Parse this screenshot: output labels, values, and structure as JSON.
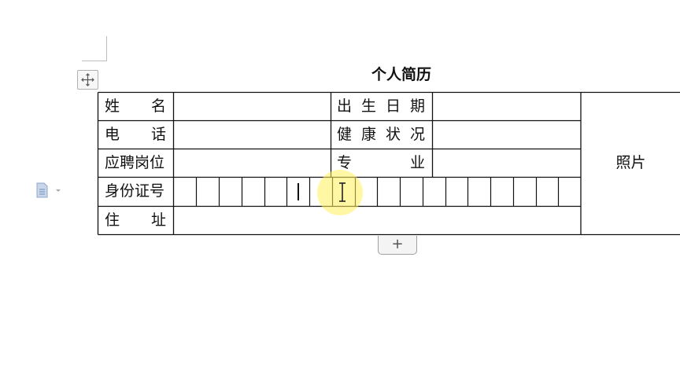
{
  "document": {
    "title": "个人简历"
  },
  "form": {
    "name_label": [
      "姓",
      "名"
    ],
    "birth_label": [
      "出",
      "生",
      "日",
      "期"
    ],
    "phone_label": [
      "电",
      "话"
    ],
    "health_label": [
      "健",
      "康",
      "状",
      "况"
    ],
    "position_label": "应聘岗位",
    "major_label": [
      "专",
      "业"
    ],
    "id_label": "身份证号",
    "address_label": [
      "住",
      "址"
    ],
    "photo_label": "照片",
    "id_digit_count": 18
  },
  "controls": {
    "add_row_label": "+"
  },
  "icons": {
    "move_handle": "move-arrows-icon",
    "doc_options": "document-icon",
    "cursor": "i-beam-cursor-icon"
  },
  "colors": {
    "cursor_highlight": "#fff05a",
    "border": "#111111"
  }
}
